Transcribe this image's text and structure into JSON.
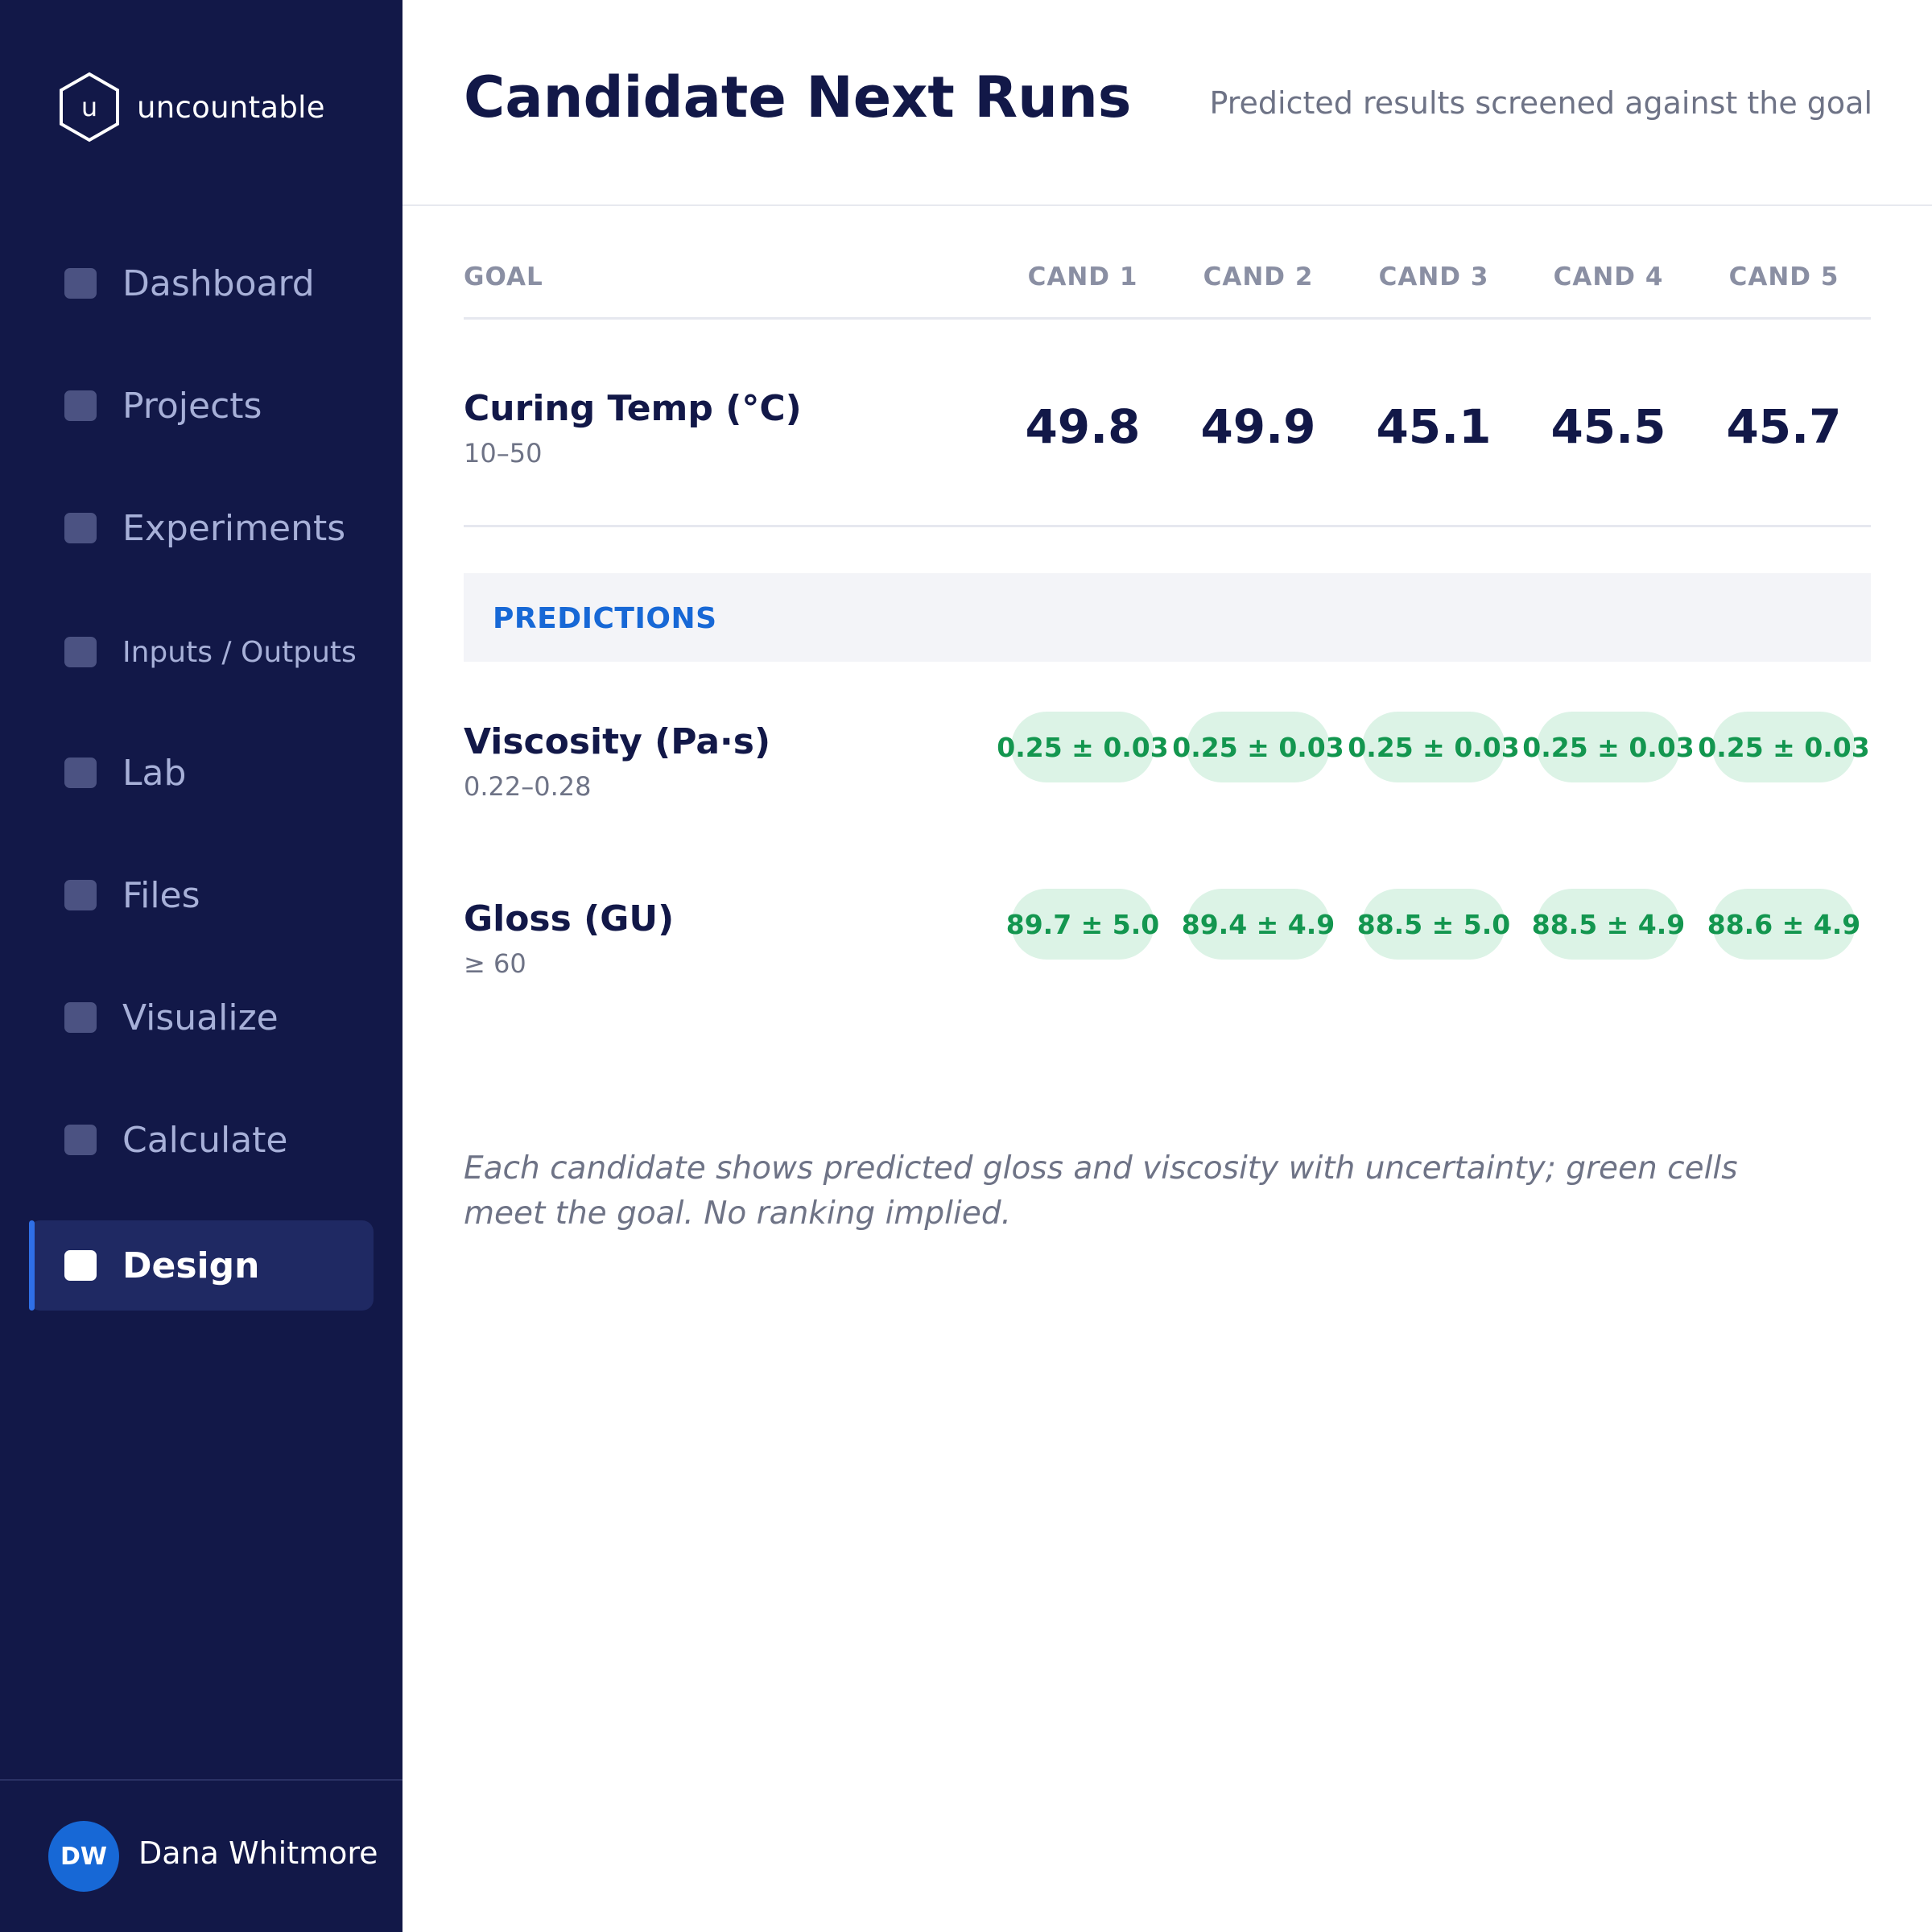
{
  "brand": {
    "logo_letter": "u",
    "name": "uncountable"
  },
  "nav": {
    "items": [
      {
        "label": "Dashboard",
        "active": false
      },
      {
        "label": "Projects",
        "active": false
      },
      {
        "label": "Experiments",
        "active": false
      },
      {
        "label": "Inputs / Outputs",
        "active": false
      },
      {
        "label": "Lab",
        "active": false
      },
      {
        "label": "Files",
        "active": false
      },
      {
        "label": "Visualize",
        "active": false
      },
      {
        "label": "Calculate",
        "active": false
      },
      {
        "label": "Design",
        "active": true
      }
    ]
  },
  "user": {
    "initials": "DW",
    "name": "Dana Whitmore"
  },
  "header": {
    "title": "Candidate Next Runs",
    "subtitle": "Predicted results screened against the goal"
  },
  "table": {
    "goal_header": "GOAL",
    "candidates": [
      "CAND 1",
      "CAND 2",
      "CAND 3",
      "CAND 4",
      "CAND 5"
    ],
    "inputs": [
      {
        "label": "Curing Temp (°C)",
        "range": "10–50",
        "values": [
          "49.8",
          "49.9",
          "45.1",
          "45.5",
          "45.7"
        ]
      }
    ],
    "predictions_header": "PREDICTIONS",
    "predictions": [
      {
        "label": "Viscosity (Pa·s)",
        "range": "0.22–0.28",
        "values": [
          "0.25 ± 0.03",
          "0.25 ± 0.03",
          "0.25 ± 0.03",
          "0.25 ± 0.03",
          "0.25 ± 0.03"
        ],
        "meets_goal": [
          true,
          true,
          true,
          true,
          true
        ]
      },
      {
        "label": "Gloss (GU)",
        "range": "≥ 60",
        "values": [
          "89.7 ± 5.0",
          "89.4 ± 4.9",
          "88.5 ± 5.0",
          "88.5 ± 4.9",
          "88.6 ± 4.9"
        ],
        "meets_goal": [
          true,
          true,
          true,
          true,
          true
        ]
      }
    ]
  },
  "note": "Each candidate shows predicted gloss and viscosity with uncertainty; green cells meet the goal. No ranking implied.",
  "colors": {
    "sidebar_bg": "#121848",
    "accent": "#1768d6",
    "meets_goal_bg": "#dcf3e6",
    "meets_goal_text": "#13964f"
  }
}
